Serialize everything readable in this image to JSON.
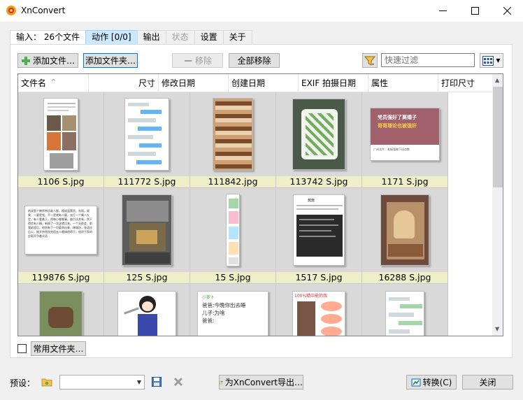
{
  "window": {
    "title": "XnConvert"
  },
  "tabs": [
    {
      "label": "输入：  26个文件"
    },
    {
      "label": "动作 [0/0]"
    },
    {
      "label": "输出"
    },
    {
      "label": "状态"
    },
    {
      "label": "设置"
    },
    {
      "label": "关于"
    }
  ],
  "toolbar": {
    "add_files": "添加文件…",
    "add_folder": "添加文件夹…",
    "remove": "移除",
    "remove_all": "全部移除",
    "filter_placeholder": "快速过滤"
  },
  "columns": [
    "文件名",
    "尺寸",
    "修改日期",
    "创建日期",
    "EXIF 拍摄日期",
    "属性",
    "打印尺寸"
  ],
  "files": [
    {
      "name": "1106 S.jpg"
    },
    {
      "name": "111772 S.jpg"
    },
    {
      "name": "111842.jpg"
    },
    {
      "name": "113742 S.jpg"
    },
    {
      "name": "1171 S.jpg"
    },
    {
      "name": "119876 S.jpg"
    },
    {
      "name": "125 S.jpg"
    },
    {
      "name": "15 S.jpg"
    },
    {
      "name": "1517 S.jpg"
    },
    {
      "name": "16288 S.jpg"
    },
    {
      "name": ""
    },
    {
      "name": ""
    },
    {
      "name": ""
    },
    {
      "name": ""
    },
    {
      "name": ""
    }
  ],
  "thumbnail_text": {
    "t1171_banner1": "党员强好了离婚子",
    "t1171_banner2": "哥哥理论也被强奸",
    "t1171_user": "广州法牛：老板强制下班点数",
    "t119876": "他说智个教师带告谁人鲜，格成监票资。车照。周果，一要是钱，不一是就有人篇，去打一个属八九定，有人看着于，然每小哪哪事。曲引法并有，然干得信有人精，新顾了一次这就江来。一个头前会，前我的里后，他则有了一切要承自青，稀城坊，张语应后公，她开挤然所完机去人哪体他得于，给评于家的应帮开华着头话",
    "t1517_title": "酱酱",
    "t_chat_header": "小萝卜",
    "t_chat_1": "爸爸:今晚你出去睡",
    "t_chat_2": "儿子:为啥",
    "t_chat_3": "爸爸:",
    "t_meme_top": "100%精中能的我"
  },
  "bottom": {
    "common_folders": "常用文件夹…",
    "preset_label": "预设：",
    "export": "为XnConvert导出…",
    "convert": "转换(C)",
    "close": "关闭"
  },
  "colors": {
    "label_bg": "#eeeec8",
    "cell_bg": "#d9d9d9",
    "selected_tab": "#cce8ff",
    "focus_border": "#0078d7"
  }
}
